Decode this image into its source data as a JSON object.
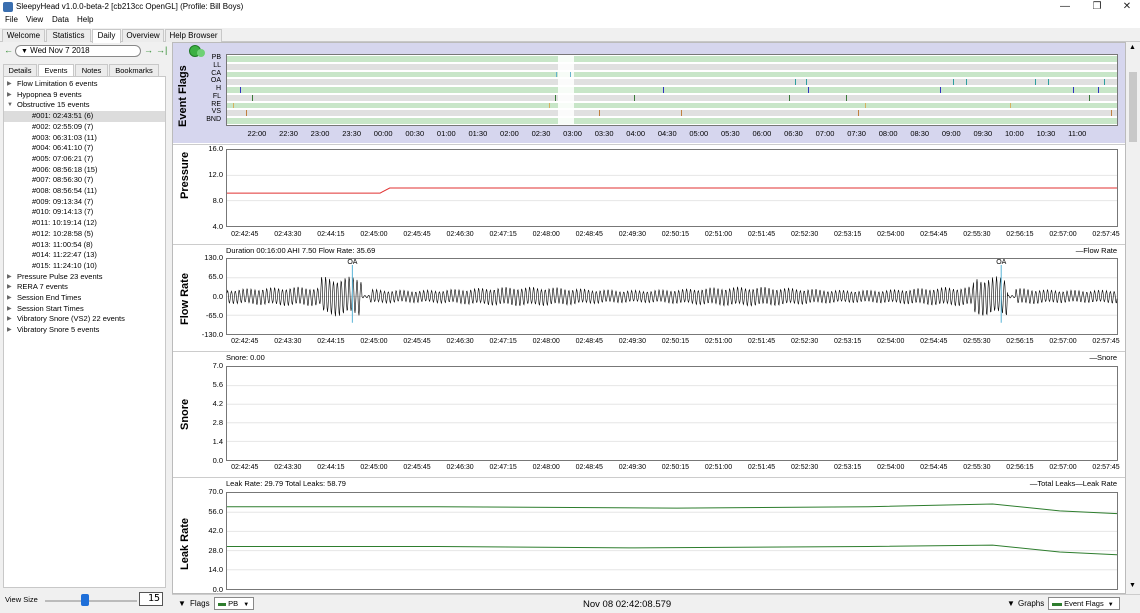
{
  "window": {
    "title": "SleepyHead v1.0.0-beta-2 [cb213cc OpenGL] (Profile: Bill Boys)",
    "minimize": "—",
    "restore": "❐",
    "close": "✕"
  },
  "menu": [
    "File",
    "View",
    "Data",
    "Help"
  ],
  "tabs": [
    "Welcome",
    "Statistics",
    "Daily",
    "Overview",
    "Help Browser"
  ],
  "active_tab": "Daily",
  "date_nav": {
    "date": "Wed Nov 7 2018",
    "prev": "←",
    "next": "→",
    "last": "→|"
  },
  "subtabs": [
    "Details",
    "Events",
    "Notes",
    "Bookmarks"
  ],
  "active_subtab": "Events",
  "events_tree": [
    {
      "label": "Flow Limitation 6 events",
      "expanded": false
    },
    {
      "label": "Hypopnea 9 events",
      "expanded": false
    },
    {
      "label": "Obstructive 15 events",
      "expanded": true,
      "children": [
        "#001: 02:43:51 (6)",
        "#002: 02:55:09 (7)",
        "#003: 06:31:03 (11)",
        "#004: 06:41:10 (7)",
        "#005: 07:06:21 (7)",
        "#006: 08:56:18 (15)",
        "#007: 08:56:30 (7)",
        "#008: 08:56:54 (11)",
        "#009: 09:13:34 (7)",
        "#010: 09:14:13 (7)",
        "#011: 10:19:14 (12)",
        "#012: 10:28:58 (5)",
        "#013: 11:00:54 (8)",
        "#014: 11:22:47 (13)",
        "#015: 11:24:10 (10)"
      ]
    },
    {
      "label": "Pressure Pulse 23 events",
      "expanded": false
    },
    {
      "label": "RERA 7 events",
      "expanded": false
    },
    {
      "label": "Session End Times",
      "expanded": false
    },
    {
      "label": "Session Start Times",
      "expanded": false
    },
    {
      "label": "Vibratory Snore (VS2)  22 events",
      "expanded": false
    },
    {
      "label": "Vibratory Snore 5 events",
      "expanded": false
    }
  ],
  "selected_event": "#001: 02:43:51 (6)",
  "view_size": {
    "label": "View Size",
    "value": "15",
    "fraction": 0.44
  },
  "flags_graph": {
    "title": "Event Flags",
    "rows": [
      "PB",
      "LL",
      "CA",
      "OA",
      "H",
      "FL",
      "RE",
      "VS",
      "BND"
    ],
    "row_colors": [
      "#c8e6c8",
      "#e0e0e0",
      "#c8e6c8",
      "#e0e0e0",
      "#c8e6c8",
      "#e0e0e0",
      "#c8e6c8",
      "#e0e0e0",
      "#c8e6c8"
    ],
    "time_labels": [
      "22:00",
      "22:30",
      "23:00",
      "23:30",
      "00:00",
      "00:30",
      "01:00",
      "01:30",
      "02:00",
      "02:30",
      "03:00",
      "03:30",
      "04:00",
      "04:30",
      "05:00",
      "05:30",
      "06:00",
      "06:30",
      "07:00",
      "07:30",
      "08:00",
      "08:30",
      "09:00",
      "09:30",
      "10:00",
      "10:30",
      "11:00"
    ],
    "time_range_hours": [
      -2.5,
      11.6
    ],
    "highlight_hours": [
      2.75,
      3.0
    ],
    "events": [
      {
        "row": "CA",
        "h": 2.72,
        "color": "#66b3cc"
      },
      {
        "row": "CA",
        "h": 2.94,
        "color": "#66b3cc"
      },
      {
        "row": "OA",
        "h": 6.5,
        "color": "#2e9e9e"
      },
      {
        "row": "OA",
        "h": 6.68,
        "color": "#2e9e9e"
      },
      {
        "row": "OA",
        "h": 9.0,
        "color": "#2e9e9e"
      },
      {
        "row": "OA",
        "h": 9.2,
        "color": "#2e9e9e"
      },
      {
        "row": "OA",
        "h": 10.3,
        "color": "#2e9e9e"
      },
      {
        "row": "OA",
        "h": 10.5,
        "color": "#2e9e9e"
      },
      {
        "row": "OA",
        "h": 11.4,
        "color": "#2e9e9e"
      },
      {
        "row": "H",
        "h": -2.3,
        "color": "#3030c0"
      },
      {
        "row": "H",
        "h": 4.4,
        "color": "#3030c0"
      },
      {
        "row": "H",
        "h": 6.7,
        "color": "#3030c0"
      },
      {
        "row": "H",
        "h": 8.8,
        "color": "#3030c0"
      },
      {
        "row": "H",
        "h": 10.9,
        "color": "#3030c0"
      },
      {
        "row": "H",
        "h": 11.3,
        "color": "#3030c0"
      },
      {
        "row": "FL",
        "h": -2.1,
        "color": "#3a7a3a"
      },
      {
        "row": "FL",
        "h": 2.7,
        "color": "#3a7a3a"
      },
      {
        "row": "FL",
        "h": 3.95,
        "color": "#3a7a3a"
      },
      {
        "row": "FL",
        "h": 6.4,
        "color": "#3a7a3a"
      },
      {
        "row": "FL",
        "h": 7.3,
        "color": "#3a7a3a"
      },
      {
        "row": "FL",
        "h": 11.15,
        "color": "#3a7a3a"
      },
      {
        "row": "RE",
        "h": -2.4,
        "color": "#d4b060"
      },
      {
        "row": "RE",
        "h": 2.6,
        "color": "#d4b060"
      },
      {
        "row": "RE",
        "h": 7.6,
        "color": "#d4b060"
      },
      {
        "row": "RE",
        "h": 9.9,
        "color": "#d4b060"
      },
      {
        "row": "VS",
        "h": -2.2,
        "color": "#c08040"
      },
      {
        "row": "VS",
        "h": 3.4,
        "color": "#c08040"
      },
      {
        "row": "VS",
        "h": 4.7,
        "color": "#c08040"
      },
      {
        "row": "VS",
        "h": 7.5,
        "color": "#c08040"
      },
      {
        "row": "VS",
        "h": 11.5,
        "color": "#c08040"
      }
    ]
  },
  "detail_time_labels": [
    "02:42:45",
    "02:43:30",
    "02:44:15",
    "02:45:00",
    "02:45:45",
    "02:46:30",
    "02:47:15",
    "02:48:00",
    "02:48:45",
    "02:49:30",
    "02:50:15",
    "02:51:00",
    "02:51:45",
    "02:52:30",
    "02:53:15",
    "02:54:00",
    "02:54:45",
    "02:55:30",
    "02:56:15",
    "02:57:00",
    "02:57:45"
  ],
  "detail_range_s": [
    -20,
    910
  ],
  "pressure": {
    "title": "Pressure",
    "yticks": [
      "16.0",
      "12.0",
      "8.0",
      "4.0"
    ],
    "ylim": [
      4,
      16
    ],
    "color": "#e03030",
    "points": [
      [
        -20,
        9.2
      ],
      [
        140,
        9.2
      ],
      [
        150,
        10.0
      ],
      [
        910,
        10.0
      ]
    ]
  },
  "flow": {
    "title": "Flow Rate",
    "info": "Duration 00:16:00 AHI 7.50 Flow Rate: 35.69",
    "legend": "—Flow Rate",
    "yticks": [
      "130.0",
      "65.0",
      "0.0",
      "-65.0",
      "-130.0"
    ],
    "ylim": [
      -130,
      130
    ],
    "oa_label": "OA",
    "oa_events_s": [
      111,
      789
    ]
  },
  "snore": {
    "title": "Snore",
    "info": "Snore: 0.00",
    "legend": "—Snore",
    "yticks": [
      "7.0",
      "5.6",
      "4.2",
      "2.8",
      "1.4",
      "0.0"
    ],
    "ylim": [
      0,
      7
    ]
  },
  "leak": {
    "title": "Leak Rate",
    "info": "Leak Rate: 29.79 Total Leaks: 58.79",
    "legend": "—Total Leaks—Leak Rate",
    "yticks": [
      "70.0",
      "56.0",
      "42.0",
      "28.0",
      "14.0",
      "0.0"
    ],
    "ylim": [
      0,
      70
    ],
    "color": "#2e7d2e",
    "total": [
      [
        -20,
        60
      ],
      [
        200,
        60
      ],
      [
        450,
        59
      ],
      [
        650,
        60
      ],
      [
        780,
        62
      ],
      [
        850,
        57
      ],
      [
        910,
        55
      ]
    ],
    "rate": [
      [
        -20,
        31
      ],
      [
        200,
        31
      ],
      [
        400,
        30
      ],
      [
        650,
        31
      ],
      [
        780,
        32
      ],
      [
        850,
        27
      ],
      [
        910,
        25
      ]
    ]
  },
  "bottom": {
    "flags_label": "Flags",
    "flags_value": "PB",
    "timestamp": "Nov 08 02:42:08.579",
    "graphs_label": "Graphs",
    "graphs_value": "Event Flags"
  }
}
